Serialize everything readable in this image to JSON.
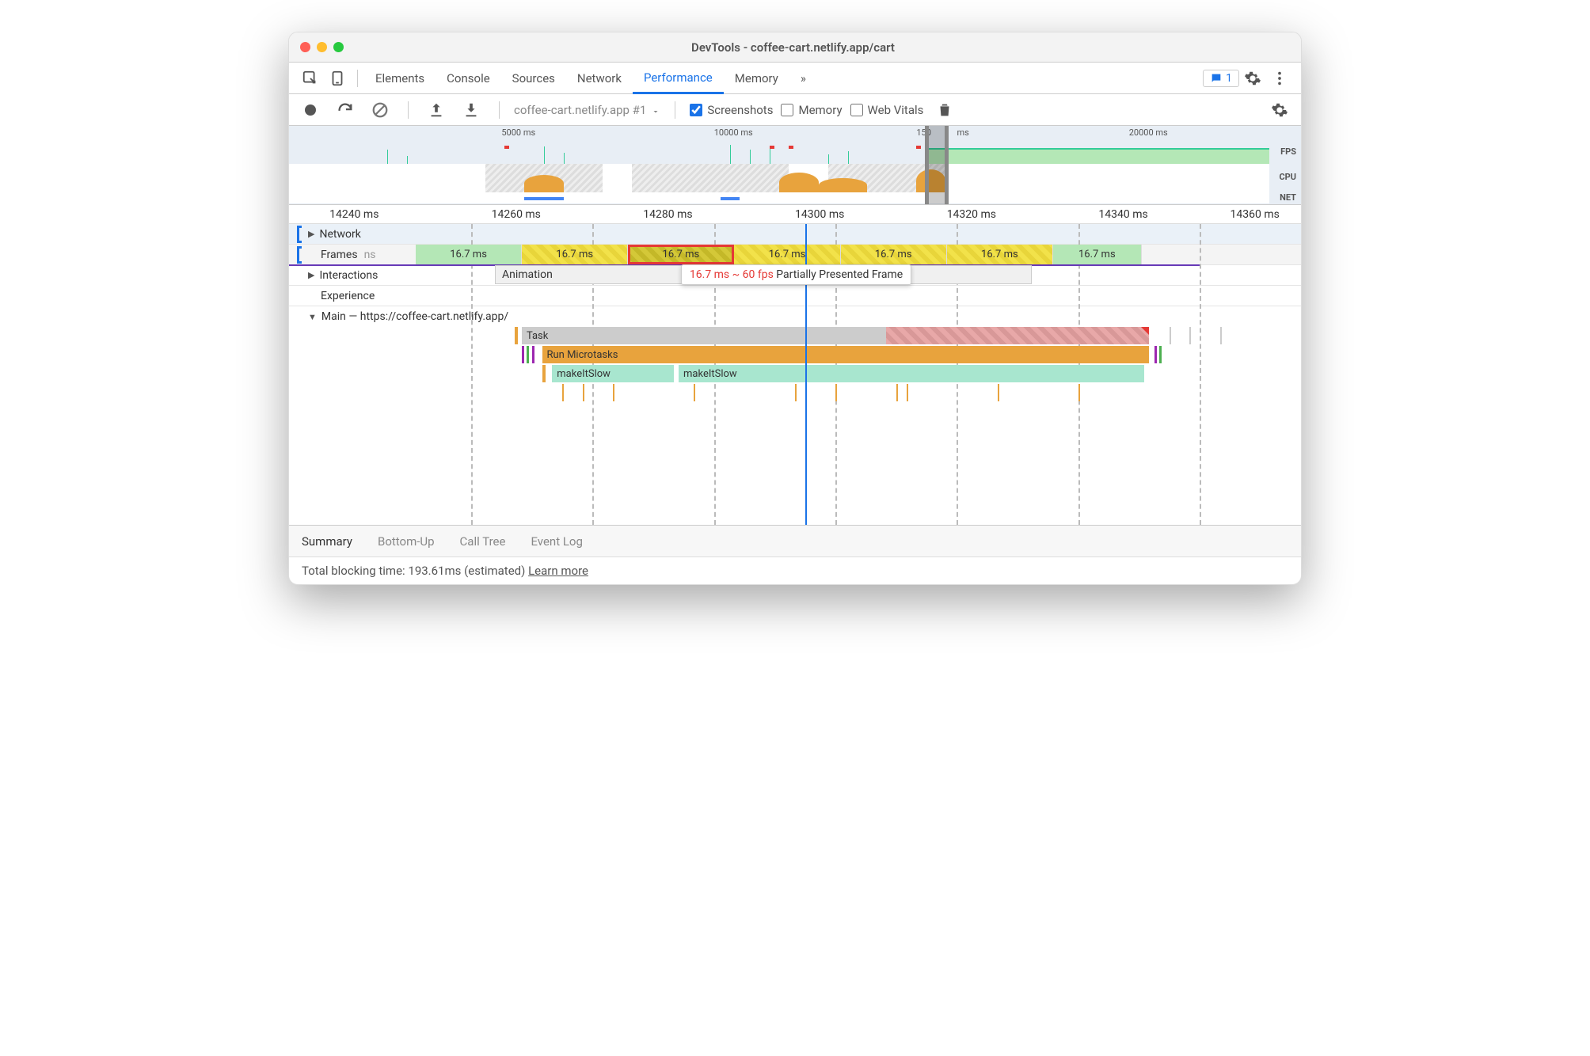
{
  "window": {
    "title": "DevTools - coffee-cart.netlify.app/cart"
  },
  "tabs": {
    "items": [
      "Elements",
      "Console",
      "Sources",
      "Network",
      "Performance",
      "Memory"
    ],
    "active": "Performance",
    "overflow": "»",
    "issues": "1"
  },
  "toolbar": {
    "profile": "coffee-cart.netlify.app #1",
    "screenshots": "Screenshots",
    "memory": "Memory",
    "webvitals": "Web Vitals"
  },
  "overview": {
    "ticks": [
      "5000 ms",
      "10000 ms",
      "150",
      "ms",
      "20000 ms"
    ],
    "fps": "FPS",
    "cpu": "CPU",
    "net": "NET"
  },
  "ruler": [
    "14240 ms",
    "14260 ms",
    "14280 ms",
    "14300 ms",
    "14320 ms",
    "14340 ms",
    "14360 ms"
  ],
  "tracks": {
    "network": "Network",
    "frames": "Frames",
    "frames_ms": "ns",
    "interactions": "Interactions",
    "animation": "Animation",
    "experience": "Experience",
    "main": "Main — https://coffee-cart.netlify.app/"
  },
  "frames": {
    "items": [
      {
        "label": "16.7 ms",
        "type": "green",
        "width": 12
      },
      {
        "label": "16.7 ms",
        "type": "yellow",
        "width": 14
      },
      {
        "label": "16.7 ms",
        "type": "yellow",
        "width": 14,
        "highlighted": true
      },
      {
        "label": "16.7 ms",
        "type": "yellow",
        "width": 14
      },
      {
        "label": "16.7 ms",
        "type": "yellow",
        "width": 14
      },
      {
        "label": "16.7 ms",
        "type": "yellow",
        "width": 14
      },
      {
        "label": "16.7 ms",
        "type": "green",
        "width": 12
      }
    ],
    "tooltip_time": "16.7 ms ~ 60 fps",
    "tooltip_desc": "Partially Presented Frame"
  },
  "flame": {
    "task": "Task",
    "microtasks": "Run Microtasks",
    "fn1": "makeItSlow",
    "fn2": "makeItSlow"
  },
  "detail_tabs": [
    "Summary",
    "Bottom-Up",
    "Call Tree",
    "Event Log"
  ],
  "footer": {
    "text": "Total blocking time: 193.61ms (estimated)",
    "link": "Learn more"
  }
}
